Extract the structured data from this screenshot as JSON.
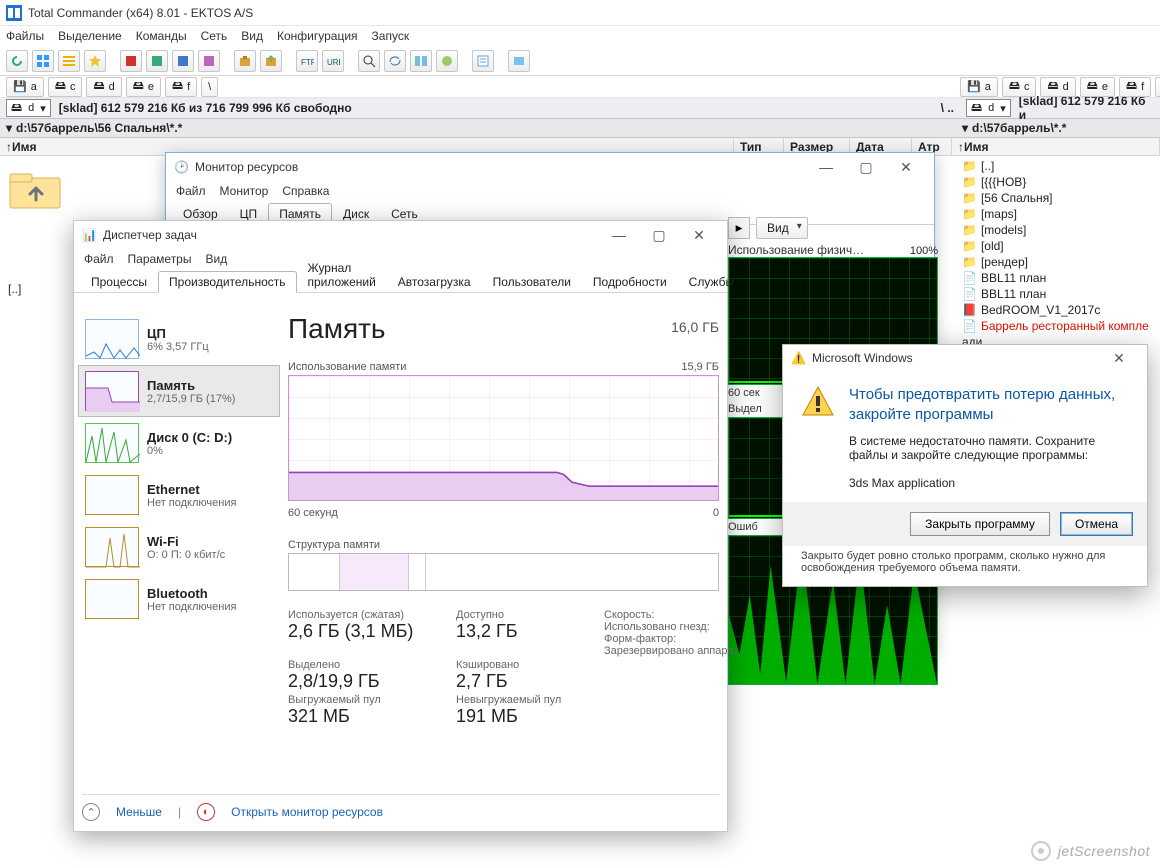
{
  "tc": {
    "title": "Total Commander (x64) 8.01 - EKTOS A/S",
    "menu": [
      "Файлы",
      "Выделение",
      "Команды",
      "Сеть",
      "Вид",
      "Конфигурация",
      "Запуск"
    ],
    "drives": [
      "a",
      "c",
      "d",
      "e",
      "f",
      "\\"
    ],
    "drive_sel_left": "d",
    "drive_sel_right": "d",
    "free_left": "[sklad]  612 579 216 Кб из 716 799 996 Кб свободно",
    "free_right": "[sklad]  612 579 216 Кб и",
    "path_left": "d:\\57баррель\\56 Спальня\\*.*",
    "path_left_prefix": "▾",
    "path_right": "d:\\57баррель\\*.*",
    "headers_left": [
      "Имя",
      "Тип",
      "Размер",
      "Дата",
      "Атр"
    ],
    "headers_right": [
      "Имя"
    ],
    "updir": "[..]",
    "right_items": [
      {
        "kind": "up",
        "label": "[..]"
      },
      {
        "kind": "dir",
        "label": "[{{{HOB}"
      },
      {
        "kind": "dir",
        "label": "[56 Спальня]"
      },
      {
        "kind": "dir",
        "label": "[maps]"
      },
      {
        "kind": "dir",
        "label": "[models]"
      },
      {
        "kind": "dir",
        "label": "[old]"
      },
      {
        "kind": "dir",
        "label": "[рендер]"
      },
      {
        "kind": "doc",
        "label": "BBL11 план"
      },
      {
        "kind": "doc",
        "label": "BBL11 план"
      },
      {
        "kind": "pdf",
        "label": "BedROOM_V1_2017c"
      },
      {
        "kind": "sel",
        "label": "Баррель ресторанный компле"
      },
      {
        "kind": "txt",
        "label": "ади"
      }
    ]
  },
  "rm": {
    "title": "Монитор ресурсов",
    "menu": [
      "Файл",
      "Монитор",
      "Справка"
    ],
    "tabs": [
      "Обзор",
      "ЦП",
      "Память",
      "Диск",
      "Сеть"
    ],
    "active_tab": "Память",
    "nav": {
      "view": "Вид"
    },
    "phys_label": "Использование физич…",
    "phys_pct": "100%",
    "sixty": "60 сек",
    "alloc": "Выдел",
    "err": "Ошиб"
  },
  "tm": {
    "title": "Диспетчер задач",
    "menu": [
      "Файл",
      "Параметры",
      "Вид"
    ],
    "tabs": [
      "Процессы",
      "Производительность",
      "Журнал приложений",
      "Автозагрузка",
      "Пользователи",
      "Подробности",
      "Службы"
    ],
    "active_tab": "Производительность",
    "left": [
      {
        "k": "cpu",
        "title": "ЦП",
        "sub": "6% 3,57 ГГц"
      },
      {
        "k": "mem",
        "title": "Память",
        "sub": "2,7/15,9 ГБ (17%)"
      },
      {
        "k": "disk",
        "title": "Диск 0 (C: D:)",
        "sub": "0%"
      },
      {
        "k": "eth",
        "title": "Ethernet",
        "sub": "Нет подключения"
      },
      {
        "k": "wifi",
        "title": "Wi-Fi",
        "sub": "О: 0 П: 0 кбит/с"
      },
      {
        "k": "bt",
        "title": "Bluetooth",
        "sub": "Нет подключения"
      }
    ],
    "h1": "Память",
    "total": "16,0 ГБ",
    "usage_label": "Использование памяти",
    "usage_right": "15,9 ГБ",
    "sixty": "60 секунд",
    "zero": "0",
    "struct_label": "Структура памяти",
    "stats": {
      "used_l": "Используется (сжатая)",
      "used_v": "2,6 ГБ (3,1 МБ)",
      "avail_l": "Доступно",
      "avail_v": "13,2 ГБ",
      "alloc_l": "Выделено",
      "alloc_v": "2,8/19,9 ГБ",
      "cache_l": "Кэшировано",
      "cache_v": "2,7 ГБ",
      "paged_l": "Выгружаемый пул",
      "paged_v": "321 МБ",
      "npaged_l": "Невыгружаемый пул",
      "npaged_v": "191 МБ",
      "speed_l": "Скорость:",
      "slots_l": "Использовано гнезд:",
      "form_l": "Форм-фактор:",
      "resv_l": "Зарезервировано аппара…"
    },
    "less": "Меньше",
    "open_rm": "Открыть монитор ресурсов"
  },
  "msg": {
    "title": "Microsoft Windows",
    "h": "Чтобы предотвратить потерю данных, закройте программы",
    "p1": "В системе недостаточно памяти. Сохраните файлы и закройте следующие программы:",
    "app": "3ds Max application",
    "btn_close": "Закрыть программу",
    "btn_cancel": "Отмена",
    "foot": "Закрыто будет ровно столько программ, сколько нужно для освобождения требуемого объема памяти."
  },
  "watermark": "jetScreenshot"
}
